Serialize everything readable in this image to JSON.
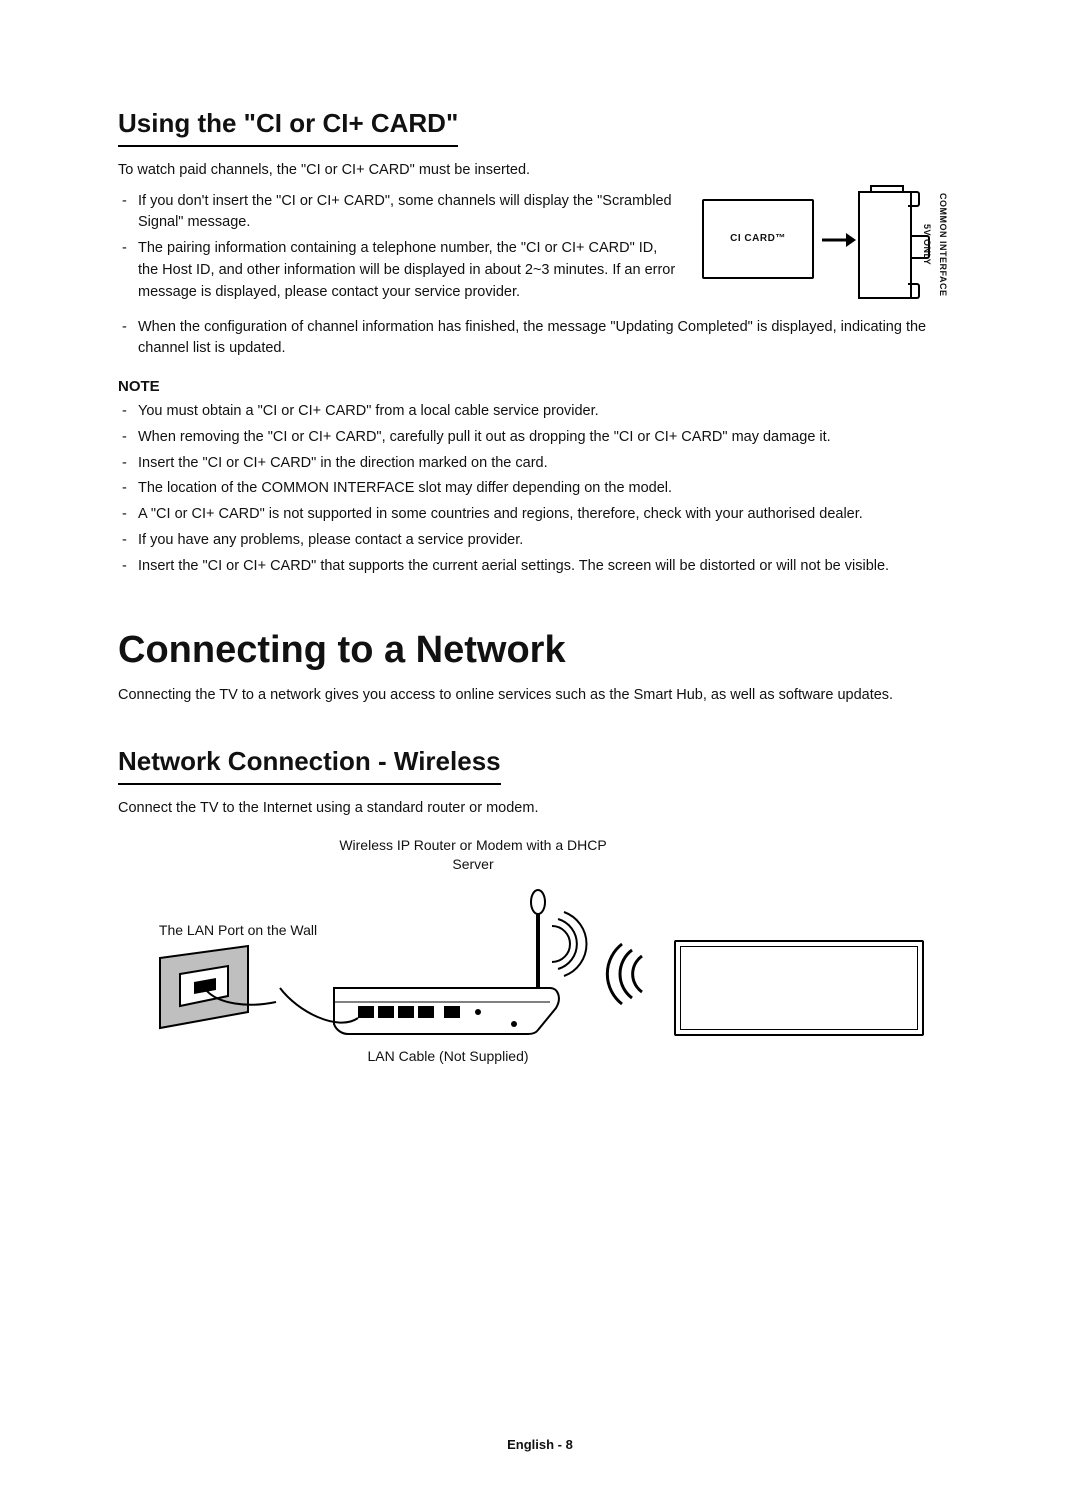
{
  "ci": {
    "heading": "Using the \"CI or CI+ CARD\"",
    "intro": "To watch paid channels, the \"CI or CI+ CARD\" must be inserted.",
    "bullets1": [
      "If you don't insert the \"CI or CI+ CARD\", some channels will display the \"Scrambled Signal\" message.",
      "The pairing information containing a telephone number, the \"CI or CI+ CARD\" ID, the Host ID, and other information will be displayed in about 2~3 minutes. If an error message is displayed, please contact your service provider."
    ],
    "bullets2": [
      "When the configuration of channel information has finished, the message \"Updating Completed\" is displayed, indicating the channel list is updated."
    ],
    "note_title": "NOTE",
    "notes": [
      "You must obtain a \"CI or CI+ CARD\" from a local cable service provider.",
      "When removing the \"CI or CI+ CARD\", carefully pull it out as dropping the \"CI or CI+ CARD\" may damage it.",
      "Insert the \"CI or CI+ CARD\" in the direction marked on the card.",
      "The location of the COMMON INTERFACE slot may differ depending on the model.",
      "A \"CI or CI+ CARD\" is not supported in some countries and regions, therefore, check with your authorised dealer.",
      "If you have any problems, please contact a service provider.",
      "Insert the \"CI or CI+ CARD\" that supports the current aerial settings. The screen will be distorted or will not be visible."
    ],
    "card_label": "CI CARD™",
    "slot_label_1": "5V ONLY",
    "slot_label_2": "COMMON INTERFACE"
  },
  "network": {
    "heading": "Connecting to a Network",
    "intro": "Connecting the TV to a network gives you access to online services such as the Smart Hub, as well as software updates.",
    "wireless_heading": "Network Connection - Wireless",
    "wireless_intro": "Connect the TV to the Internet using a standard router or modem.",
    "router_label": "Wireless IP Router or Modem with a DHCP Server",
    "wall_label": "The LAN Port on the Wall",
    "cable_label": "LAN Cable (Not Supplied)"
  },
  "footer": "English - 8"
}
